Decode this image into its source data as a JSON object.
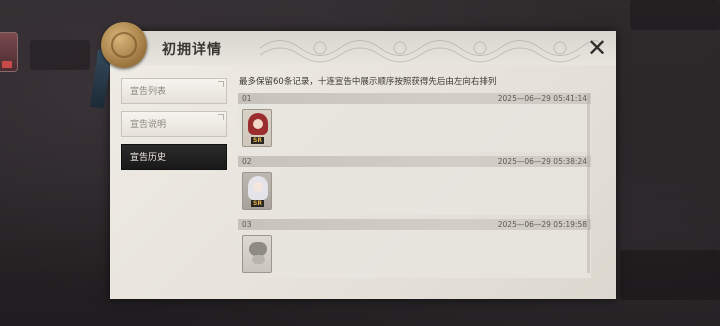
{
  "panel": {
    "title": "初拥详情",
    "close_icon": "close-x-icon"
  },
  "tabs": [
    {
      "label": "宣告列表",
      "active": false
    },
    {
      "label": "宣告说明",
      "active": false
    },
    {
      "label": "宣告历史",
      "active": true
    }
  ],
  "notice": "最多保留60条记录，十连宣告中展示顺序按照获得先后由左向右排列",
  "records": [
    {
      "index": "01",
      "time": "2025—06—29 05:41:14",
      "character": {
        "badge": "SR",
        "style": "red-hair"
      }
    },
    {
      "index": "02",
      "time": "2025—06—29 05:38:24",
      "character": {
        "badge": "SR",
        "style": "white-hair"
      }
    },
    {
      "index": "03",
      "time": "2025—06—29 05:19:58",
      "character": {
        "badge": "",
        "style": "grey-creature"
      }
    }
  ],
  "colors": {
    "panel_bg": "#ece9e2",
    "active_tab": "#1f1e1f",
    "badge_gold": "#e3b04b"
  }
}
